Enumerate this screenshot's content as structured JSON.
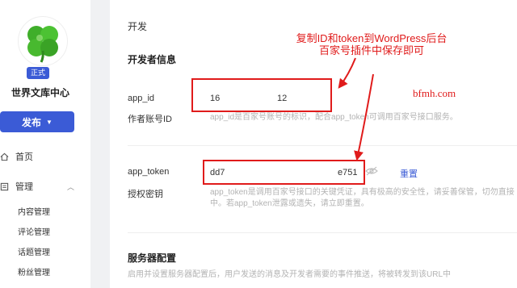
{
  "sidebar": {
    "badge": "正式",
    "site_name": "世界文库中心",
    "publish_label": "发布",
    "nav": {
      "home": "首页",
      "manage": "管理"
    },
    "sub_items": [
      "内容管理",
      "评论管理",
      "话题管理",
      "粉丝管理"
    ]
  },
  "main": {
    "breadcrumb": "开发",
    "dev_info_title": "开发者信息",
    "app_id": {
      "label": "app_id",
      "sublabel": "作者账号ID",
      "value_left": "16",
      "value_right": "12",
      "desc": "app_id是百家号账号的标识，配合app_token可调用百家号接口服务。"
    },
    "app_token": {
      "label": "app_token",
      "sublabel": "授权密钥",
      "value_left": "dd7",
      "value_right": "e751",
      "reset_label": "重置",
      "desc_line1": "app_token是调用百家号接口的关键凭证，具有极高的安全性，请妥善保管，切勿直接",
      "desc_line2": "中。若app_token泄露或遗失，请立即重置。"
    },
    "server_title": "服务器配置",
    "server_desc": "启用并设置服务器配置后，用户发送的消息及开发者需要的事件推送，将被转发到该URL中"
  },
  "annotation": {
    "line1": "复制ID和token到WordPress后台",
    "line2": "百家号插件中保存即可",
    "watermark": "bfmh.com"
  },
  "colors": {
    "accent": "#3b5bd6",
    "annotation_red": "#e01b1b"
  }
}
